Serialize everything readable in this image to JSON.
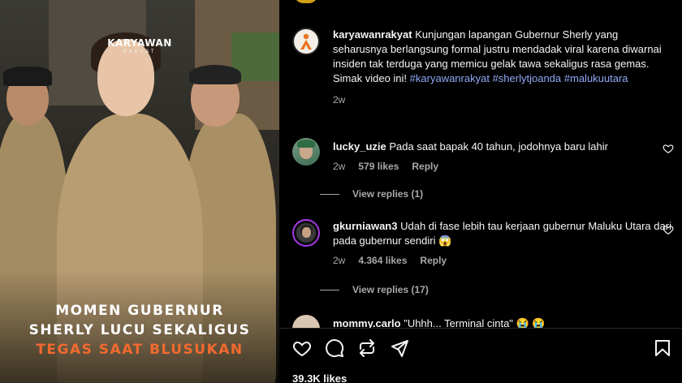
{
  "media": {
    "brand": "KARYAWAN",
    "brand_sub": "RAKYAT",
    "caption_lines": [
      "MOMEN GUBERNUR",
      "SHERLY LUCU SEKALIGUS",
      "TEGAS SAAT BLUSUKAN"
    ],
    "caption_accent": "#f26a2e"
  },
  "caption": {
    "username": "karyawanrakyat",
    "text": "Kunjungan lapangan Gubernur Sherly yang seharusnya berlangsung formal justru mendadak viral karena diwarnai insiden tak terduga yang memicu gelak tawa sekaligus rasa gemas. Simak video ini!",
    "hashtags": [
      "#karyawanrakyat",
      "#sherlytjoanda",
      "#malukuutara"
    ],
    "time": "2w"
  },
  "comments": [
    {
      "username": "lucky_uzie",
      "text": "Pada saat bapak 40 tahun, jodohnya baru lahir",
      "time": "2w",
      "likes": "579 likes",
      "reply": "Reply",
      "view_replies": "View replies (1)",
      "icon": "heart-outline-icon"
    },
    {
      "username": "gkurniawan3",
      "text": "Udah di fase lebih tau kerjaan gubernur Maluku Utara dari pada gubernur sendiri",
      "emoji": "😱",
      "time": "2w",
      "likes": "4.364 likes",
      "reply": "Reply",
      "view_replies": "View replies (17)",
      "icon": "heart-outline-icon"
    },
    {
      "username": "mommy.carlo",
      "text": "\"Uhhh... Terminal cinta\"",
      "emoji": "😭 😭"
    }
  ],
  "actions": {
    "icons": [
      "heart-icon",
      "comment-icon",
      "repost-icon",
      "share-icon",
      "bookmark-icon"
    ],
    "likes": "39.3K likes"
  },
  "colors": {
    "background": "#000000",
    "text": "#f5f5f5",
    "muted": "#a8a8a8",
    "hashtag": "#90a9f7"
  }
}
